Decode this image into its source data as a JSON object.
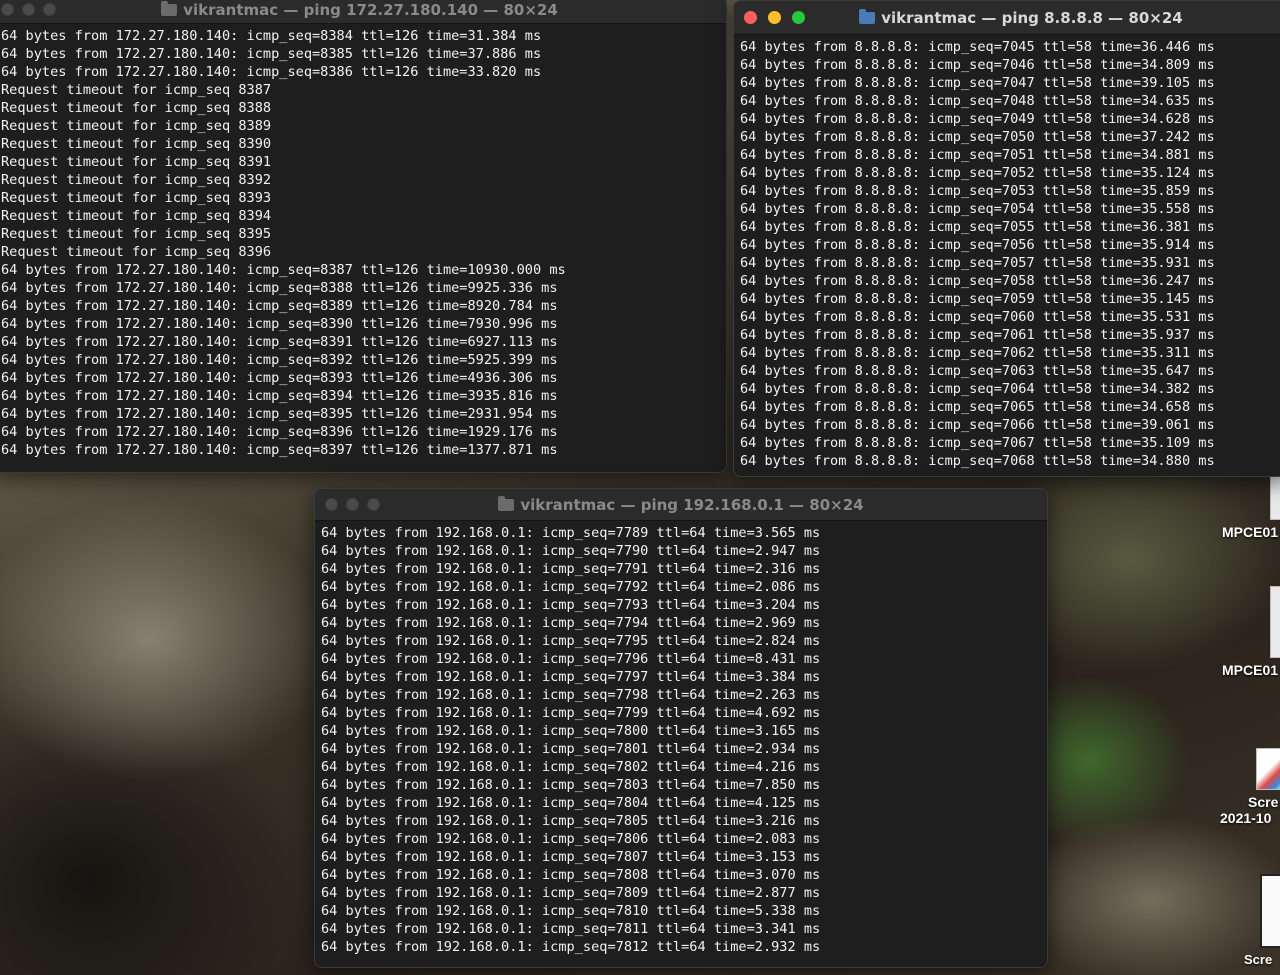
{
  "desktop": {
    "icons": [
      {
        "label": "MPCE01"
      },
      {
        "label": "MPCE01"
      },
      {
        "label": "Scre",
        "sublabel": "2021-10"
      },
      {
        "label": "Scre"
      }
    ]
  },
  "windows": [
    {
      "title": "vikrantmac — ping 172.27.180.140 — 80×24",
      "focused": false,
      "lines": [
        "64 bytes from 172.27.180.140: icmp_seq=8384 ttl=126 time=31.384 ms",
        "64 bytes from 172.27.180.140: icmp_seq=8385 ttl=126 time=37.886 ms",
        "64 bytes from 172.27.180.140: icmp_seq=8386 ttl=126 time=33.820 ms",
        "Request timeout for icmp_seq 8387",
        "Request timeout for icmp_seq 8388",
        "Request timeout for icmp_seq 8389",
        "Request timeout for icmp_seq 8390",
        "Request timeout for icmp_seq 8391",
        "Request timeout for icmp_seq 8392",
        "Request timeout for icmp_seq 8393",
        "Request timeout for icmp_seq 8394",
        "Request timeout for icmp_seq 8395",
        "Request timeout for icmp_seq 8396",
        "64 bytes from 172.27.180.140: icmp_seq=8387 ttl=126 time=10930.000 ms",
        "64 bytes from 172.27.180.140: icmp_seq=8388 ttl=126 time=9925.336 ms",
        "64 bytes from 172.27.180.140: icmp_seq=8389 ttl=126 time=8920.784 ms",
        "64 bytes from 172.27.180.140: icmp_seq=8390 ttl=126 time=7930.996 ms",
        "64 bytes from 172.27.180.140: icmp_seq=8391 ttl=126 time=6927.113 ms",
        "64 bytes from 172.27.180.140: icmp_seq=8392 ttl=126 time=5925.399 ms",
        "64 bytes from 172.27.180.140: icmp_seq=8393 ttl=126 time=4936.306 ms",
        "64 bytes from 172.27.180.140: icmp_seq=8394 ttl=126 time=3935.816 ms",
        "64 bytes from 172.27.180.140: icmp_seq=8395 ttl=126 time=2931.954 ms",
        "64 bytes from 172.27.180.140: icmp_seq=8396 ttl=126 time=1929.176 ms",
        "64 bytes from 172.27.180.140: icmp_seq=8397 ttl=126 time=1377.871 ms"
      ]
    },
    {
      "title": "vikrantmac — ping 8.8.8.8 — 80×24",
      "focused": true,
      "lines": [
        "64 bytes from 8.8.8.8: icmp_seq=7045 ttl=58 time=36.446 ms",
        "64 bytes from 8.8.8.8: icmp_seq=7046 ttl=58 time=34.809 ms",
        "64 bytes from 8.8.8.8: icmp_seq=7047 ttl=58 time=39.105 ms",
        "64 bytes from 8.8.8.8: icmp_seq=7048 ttl=58 time=34.635 ms",
        "64 bytes from 8.8.8.8: icmp_seq=7049 ttl=58 time=34.628 ms",
        "64 bytes from 8.8.8.8: icmp_seq=7050 ttl=58 time=37.242 ms",
        "64 bytes from 8.8.8.8: icmp_seq=7051 ttl=58 time=34.881 ms",
        "64 bytes from 8.8.8.8: icmp_seq=7052 ttl=58 time=35.124 ms",
        "64 bytes from 8.8.8.8: icmp_seq=7053 ttl=58 time=35.859 ms",
        "64 bytes from 8.8.8.8: icmp_seq=7054 ttl=58 time=35.558 ms",
        "64 bytes from 8.8.8.8: icmp_seq=7055 ttl=58 time=36.381 ms",
        "64 bytes from 8.8.8.8: icmp_seq=7056 ttl=58 time=35.914 ms",
        "64 bytes from 8.8.8.8: icmp_seq=7057 ttl=58 time=35.931 ms",
        "64 bytes from 8.8.8.8: icmp_seq=7058 ttl=58 time=36.247 ms",
        "64 bytes from 8.8.8.8: icmp_seq=7059 ttl=58 time=35.145 ms",
        "64 bytes from 8.8.8.8: icmp_seq=7060 ttl=58 time=35.531 ms",
        "64 bytes from 8.8.8.8: icmp_seq=7061 ttl=58 time=35.937 ms",
        "64 bytes from 8.8.8.8: icmp_seq=7062 ttl=58 time=35.311 ms",
        "64 bytes from 8.8.8.8: icmp_seq=7063 ttl=58 time=35.647 ms",
        "64 bytes from 8.8.8.8: icmp_seq=7064 ttl=58 time=34.382 ms",
        "64 bytes from 8.8.8.8: icmp_seq=7065 ttl=58 time=34.658 ms",
        "64 bytes from 8.8.8.8: icmp_seq=7066 ttl=58 time=39.061 ms",
        "64 bytes from 8.8.8.8: icmp_seq=7067 ttl=58 time=35.109 ms",
        "64 bytes from 8.8.8.8: icmp_seq=7068 ttl=58 time=34.880 ms"
      ]
    },
    {
      "title": "vikrantmac — ping 192.168.0.1 — 80×24",
      "focused": false,
      "lines": [
        "64 bytes from 192.168.0.1: icmp_seq=7789 ttl=64 time=3.565 ms",
        "64 bytes from 192.168.0.1: icmp_seq=7790 ttl=64 time=2.947 ms",
        "64 bytes from 192.168.0.1: icmp_seq=7791 ttl=64 time=2.316 ms",
        "64 bytes from 192.168.0.1: icmp_seq=7792 ttl=64 time=2.086 ms",
        "64 bytes from 192.168.0.1: icmp_seq=7793 ttl=64 time=3.204 ms",
        "64 bytes from 192.168.0.1: icmp_seq=7794 ttl=64 time=2.969 ms",
        "64 bytes from 192.168.0.1: icmp_seq=7795 ttl=64 time=2.824 ms",
        "64 bytes from 192.168.0.1: icmp_seq=7796 ttl=64 time=8.431 ms",
        "64 bytes from 192.168.0.1: icmp_seq=7797 ttl=64 time=3.384 ms",
        "64 bytes from 192.168.0.1: icmp_seq=7798 ttl=64 time=2.263 ms",
        "64 bytes from 192.168.0.1: icmp_seq=7799 ttl=64 time=4.692 ms",
        "64 bytes from 192.168.0.1: icmp_seq=7800 ttl=64 time=3.165 ms",
        "64 bytes from 192.168.0.1: icmp_seq=7801 ttl=64 time=2.934 ms",
        "64 bytes from 192.168.0.1: icmp_seq=7802 ttl=64 time=4.216 ms",
        "64 bytes from 192.168.0.1: icmp_seq=7803 ttl=64 time=7.850 ms",
        "64 bytes from 192.168.0.1: icmp_seq=7804 ttl=64 time=4.125 ms",
        "64 bytes from 192.168.0.1: icmp_seq=7805 ttl=64 time=3.216 ms",
        "64 bytes from 192.168.0.1: icmp_seq=7806 ttl=64 time=2.083 ms",
        "64 bytes from 192.168.0.1: icmp_seq=7807 ttl=64 time=3.153 ms",
        "64 bytes from 192.168.0.1: icmp_seq=7808 ttl=64 time=3.070 ms",
        "64 bytes from 192.168.0.1: icmp_seq=7809 ttl=64 time=2.877 ms",
        "64 bytes from 192.168.0.1: icmp_seq=7810 ttl=64 time=5.338 ms",
        "64 bytes from 192.168.0.1: icmp_seq=7811 ttl=64 time=3.341 ms",
        "64 bytes from 192.168.0.1: icmp_seq=7812 ttl=64 time=2.932 ms"
      ]
    }
  ]
}
